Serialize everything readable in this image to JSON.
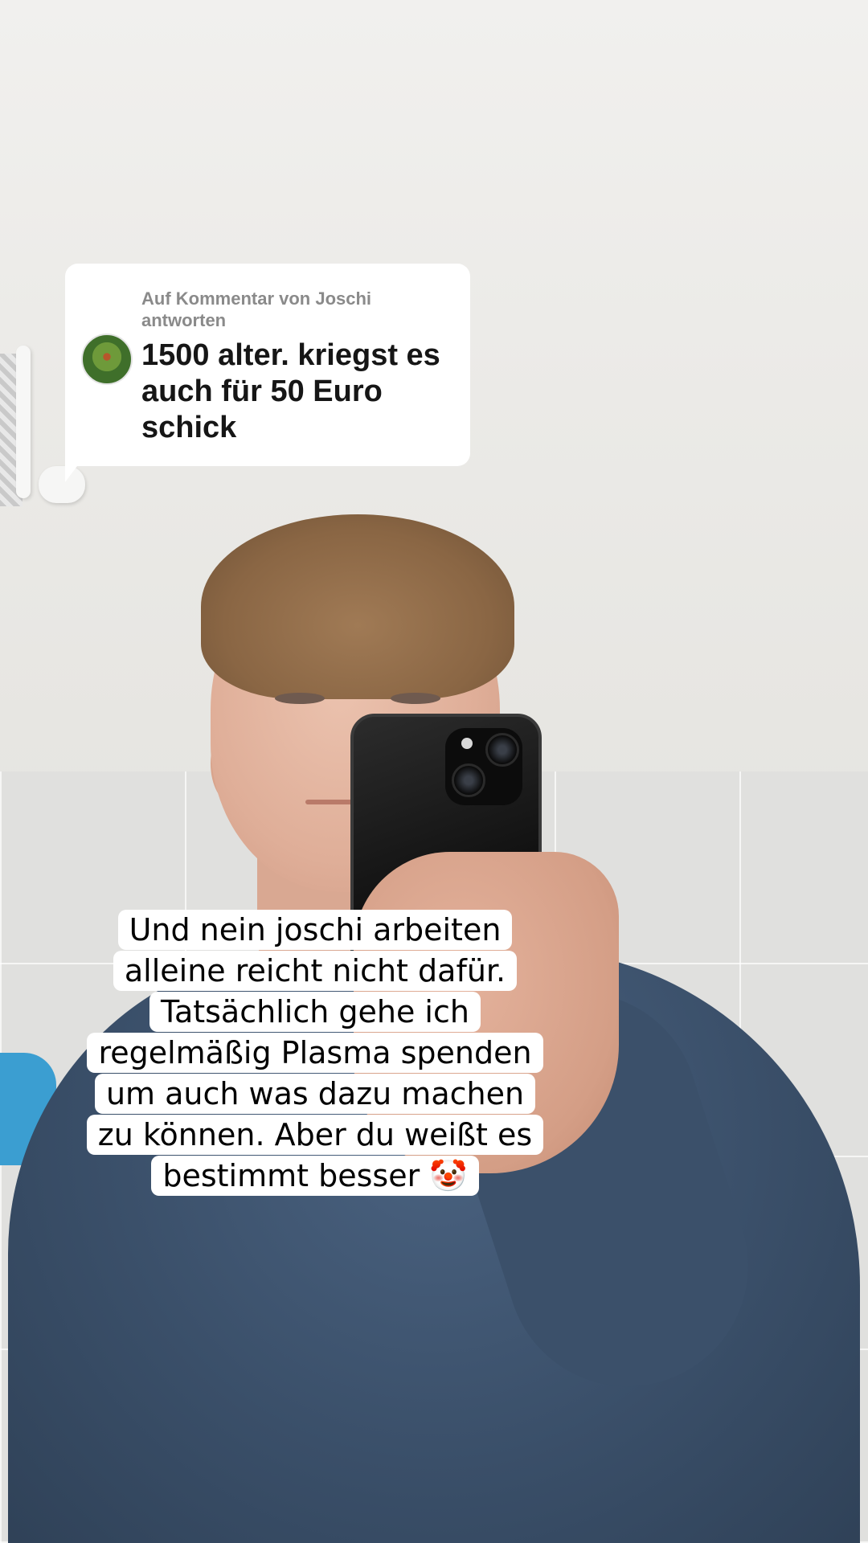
{
  "reply_sticker": {
    "header": "Auf Kommentar von Joschi antworten",
    "comment": "1500 alter. kriegst es auch für 50 Euro schick"
  },
  "caption": {
    "lines": [
      "Und nein joschi arbeiten",
      "alleine reicht nicht dafür.",
      "Tatsächlich gehe ich",
      "regelmäßig Plasma spenden",
      "um auch was dazu machen",
      "zu können. Aber du weißt es",
      "bestimmt besser 🤡"
    ]
  },
  "icons": {
    "commenter_avatar": "avatar-icon",
    "clown_emoji": "clown-face-emoji"
  }
}
